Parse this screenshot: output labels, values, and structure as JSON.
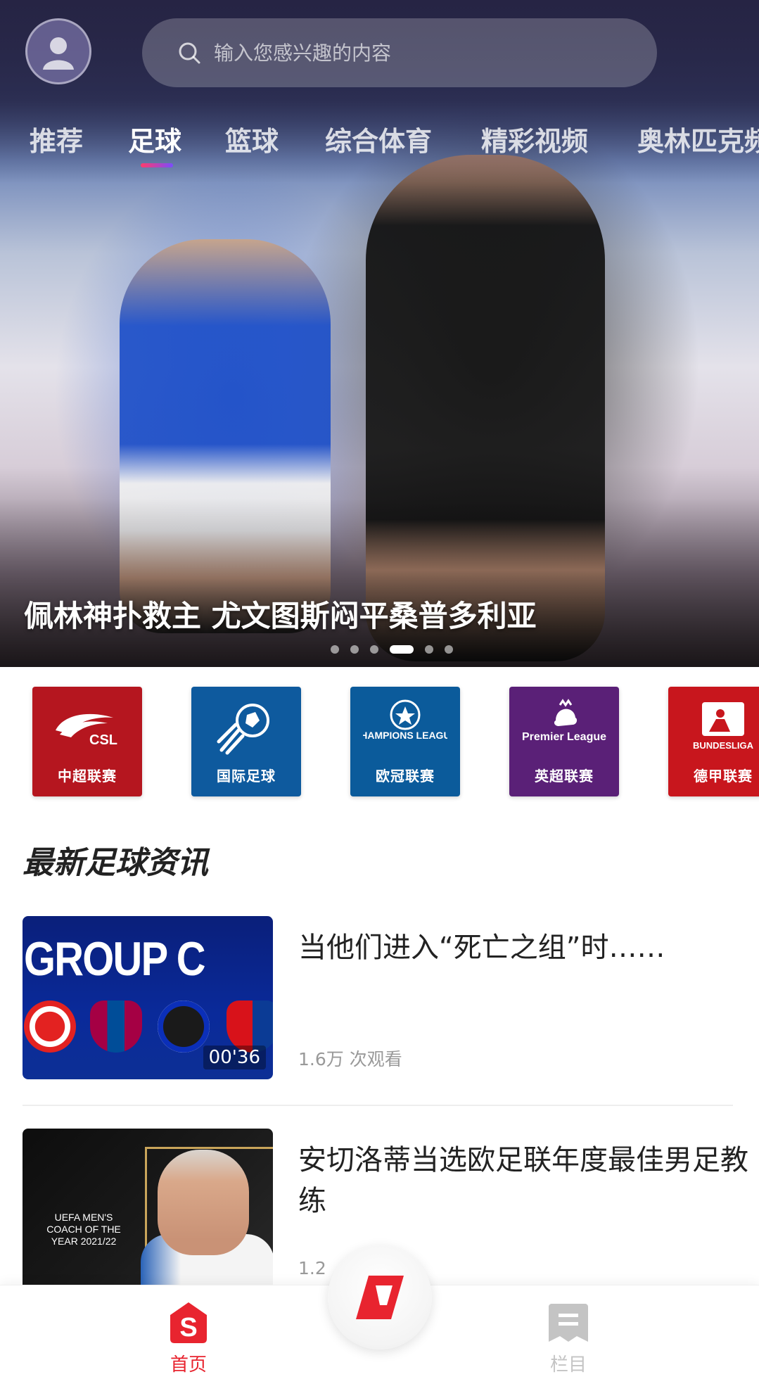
{
  "search": {
    "placeholder": "输入您感兴趣的内容"
  },
  "tabs": [
    {
      "label": "推荐",
      "active": false
    },
    {
      "label": "足球",
      "active": true
    },
    {
      "label": "篮球",
      "active": false
    },
    {
      "label": "综合体育",
      "active": false
    },
    {
      "label": "精彩视频",
      "active": false
    },
    {
      "label": "奥林匹克频",
      "active": false
    }
  ],
  "hero": {
    "title": "佩林神扑救主 尤文图斯闷平桑普多利亚",
    "slide_count": 6,
    "active_slide": 3
  },
  "leagues": [
    {
      "name": "中超联赛",
      "emblem": "CSL",
      "color": "#b5161f"
    },
    {
      "name": "国际足球",
      "emblem": "football-icon",
      "color": "#0e5a9e"
    },
    {
      "name": "欧冠联赛",
      "emblem": "CHAMPIONS LEAGUE",
      "color": "#0b5b9b"
    },
    {
      "name": "英超联赛",
      "emblem": "Premier League",
      "color": "#5a2077"
    },
    {
      "name": "德甲联赛",
      "emblem": "BUNDESLIGA",
      "color": "#c8161d"
    }
  ],
  "section": {
    "title": "最新足球资讯"
  },
  "news": [
    {
      "headline": "当他们进入“死亡之组”时……",
      "views": "1.6万 次观看",
      "thumb_text": "GROUP C",
      "duration": "00'36"
    },
    {
      "headline": "安切洛蒂当选欧足联年度最佳男足教练",
      "views": "1.2",
      "thumb_text": "UEFA MEN'S COACH OF THE YEAR 2021/22"
    }
  ],
  "bottom_nav": [
    {
      "label": "首页",
      "active": true,
      "icon": "home-icon"
    },
    {
      "label": "栏目",
      "active": false,
      "icon": "column-icon"
    }
  ],
  "colors": {
    "accent": "#e8242f",
    "inactive": "#c4c4c4"
  }
}
